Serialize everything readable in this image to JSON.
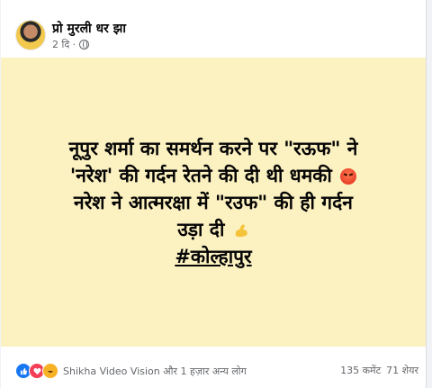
{
  "post": {
    "author": "प्रो मुरली धर झा",
    "time": "2 दि ·",
    "lines": [
      "नूपुर शर्मा का समर्थन करने पर \"रऊफ\" ने",
      "'नरेश' की गर्दन रेतने की दी थी धमकी",
      "नरेश ने आत्मरक्षा में \"रउफ\" की ही गर्दन",
      "उड़ा दी",
      "#कोल्हापुर"
    ],
    "background_color": "#fcf1c1"
  },
  "footer": {
    "reaction_text": "Shikha Video Vision और 1 हज़ार अन्य लोग",
    "comments": "135 कमेंट",
    "shares": "71 शेयर"
  },
  "icons": [
    "globe-icon",
    "angry-emoji-icon",
    "flexed-biceps-icon",
    "like-icon",
    "love-icon",
    "haha-icon"
  ]
}
